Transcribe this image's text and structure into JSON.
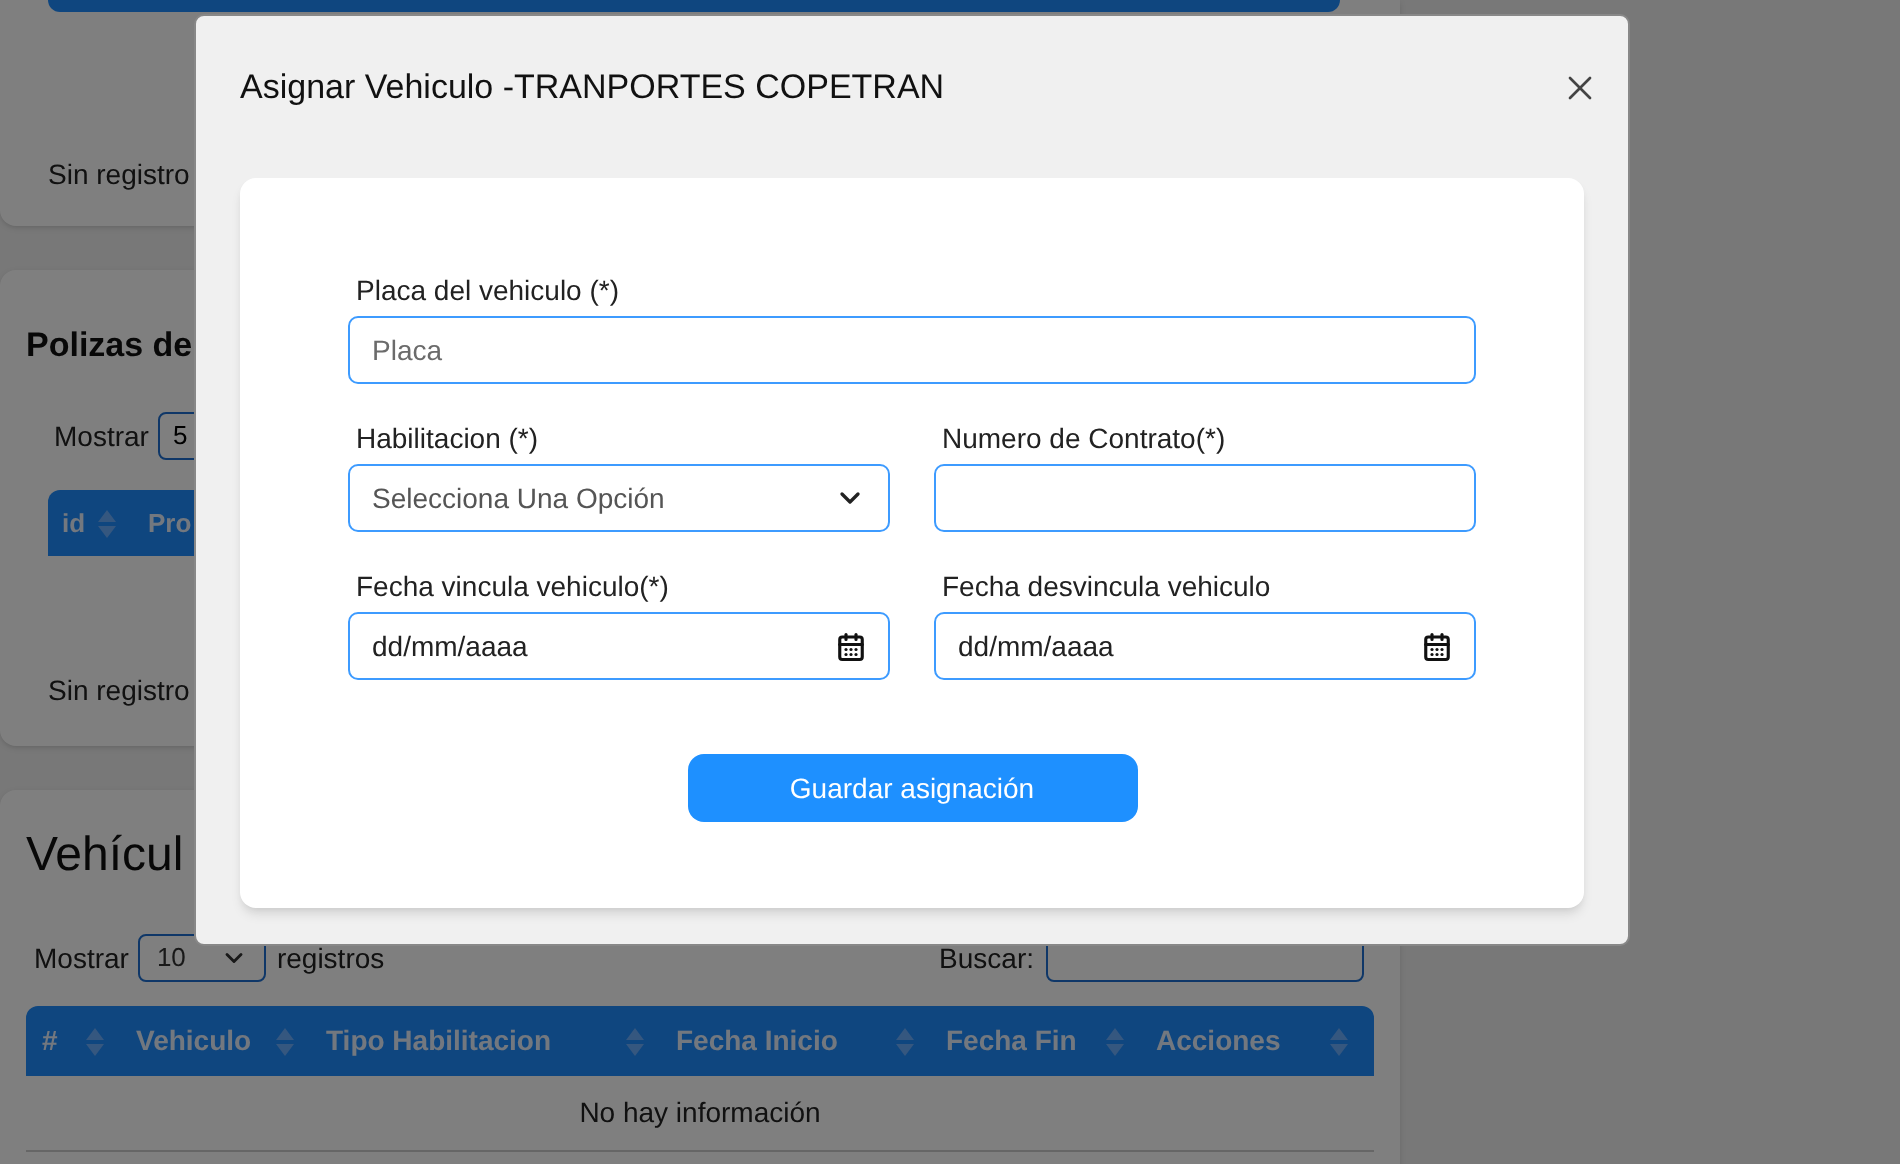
{
  "background": {
    "top_table": {
      "empty_text": "Sin registro"
    },
    "polizas": {
      "title": "Polizas de",
      "show_label": "Mostrar",
      "page_size": "5",
      "columns": [
        "id",
        "Pro"
      ],
      "empty_text": "Sin registro"
    },
    "vehiculos": {
      "title": "Vehícul",
      "show_label": "Mostrar",
      "page_size": "10",
      "records_label": "registros",
      "search_label": "Buscar:",
      "columns": [
        "#",
        "Vehiculo",
        "Tipo Habilitacion",
        "Fecha Inicio",
        "Fecha Fin",
        "Acciones"
      ],
      "empty_text": "No hay información"
    }
  },
  "modal": {
    "title": "Asignar Vehiculo -TRANPORTES COPETRAN",
    "rows": [
      [
        {
          "kind": "text",
          "label": "Placa del vehiculo (*)",
          "placeholder": "Placa"
        }
      ],
      [
        {
          "kind": "select",
          "label": "Habilitacion (*)",
          "value": "Selecciona Una Opción"
        },
        {
          "kind": "text",
          "label": "Numero de Contrato(*)"
        }
      ],
      [
        {
          "kind": "date",
          "label": "Fecha vincula vehiculo(*)",
          "value": "dd/mm/aaaa"
        },
        {
          "kind": "date",
          "label": "Fecha desvincula vehiculo",
          "value": "dd/mm/aaaa"
        }
      ]
    ],
    "button": "Guardar asignación"
  }
}
